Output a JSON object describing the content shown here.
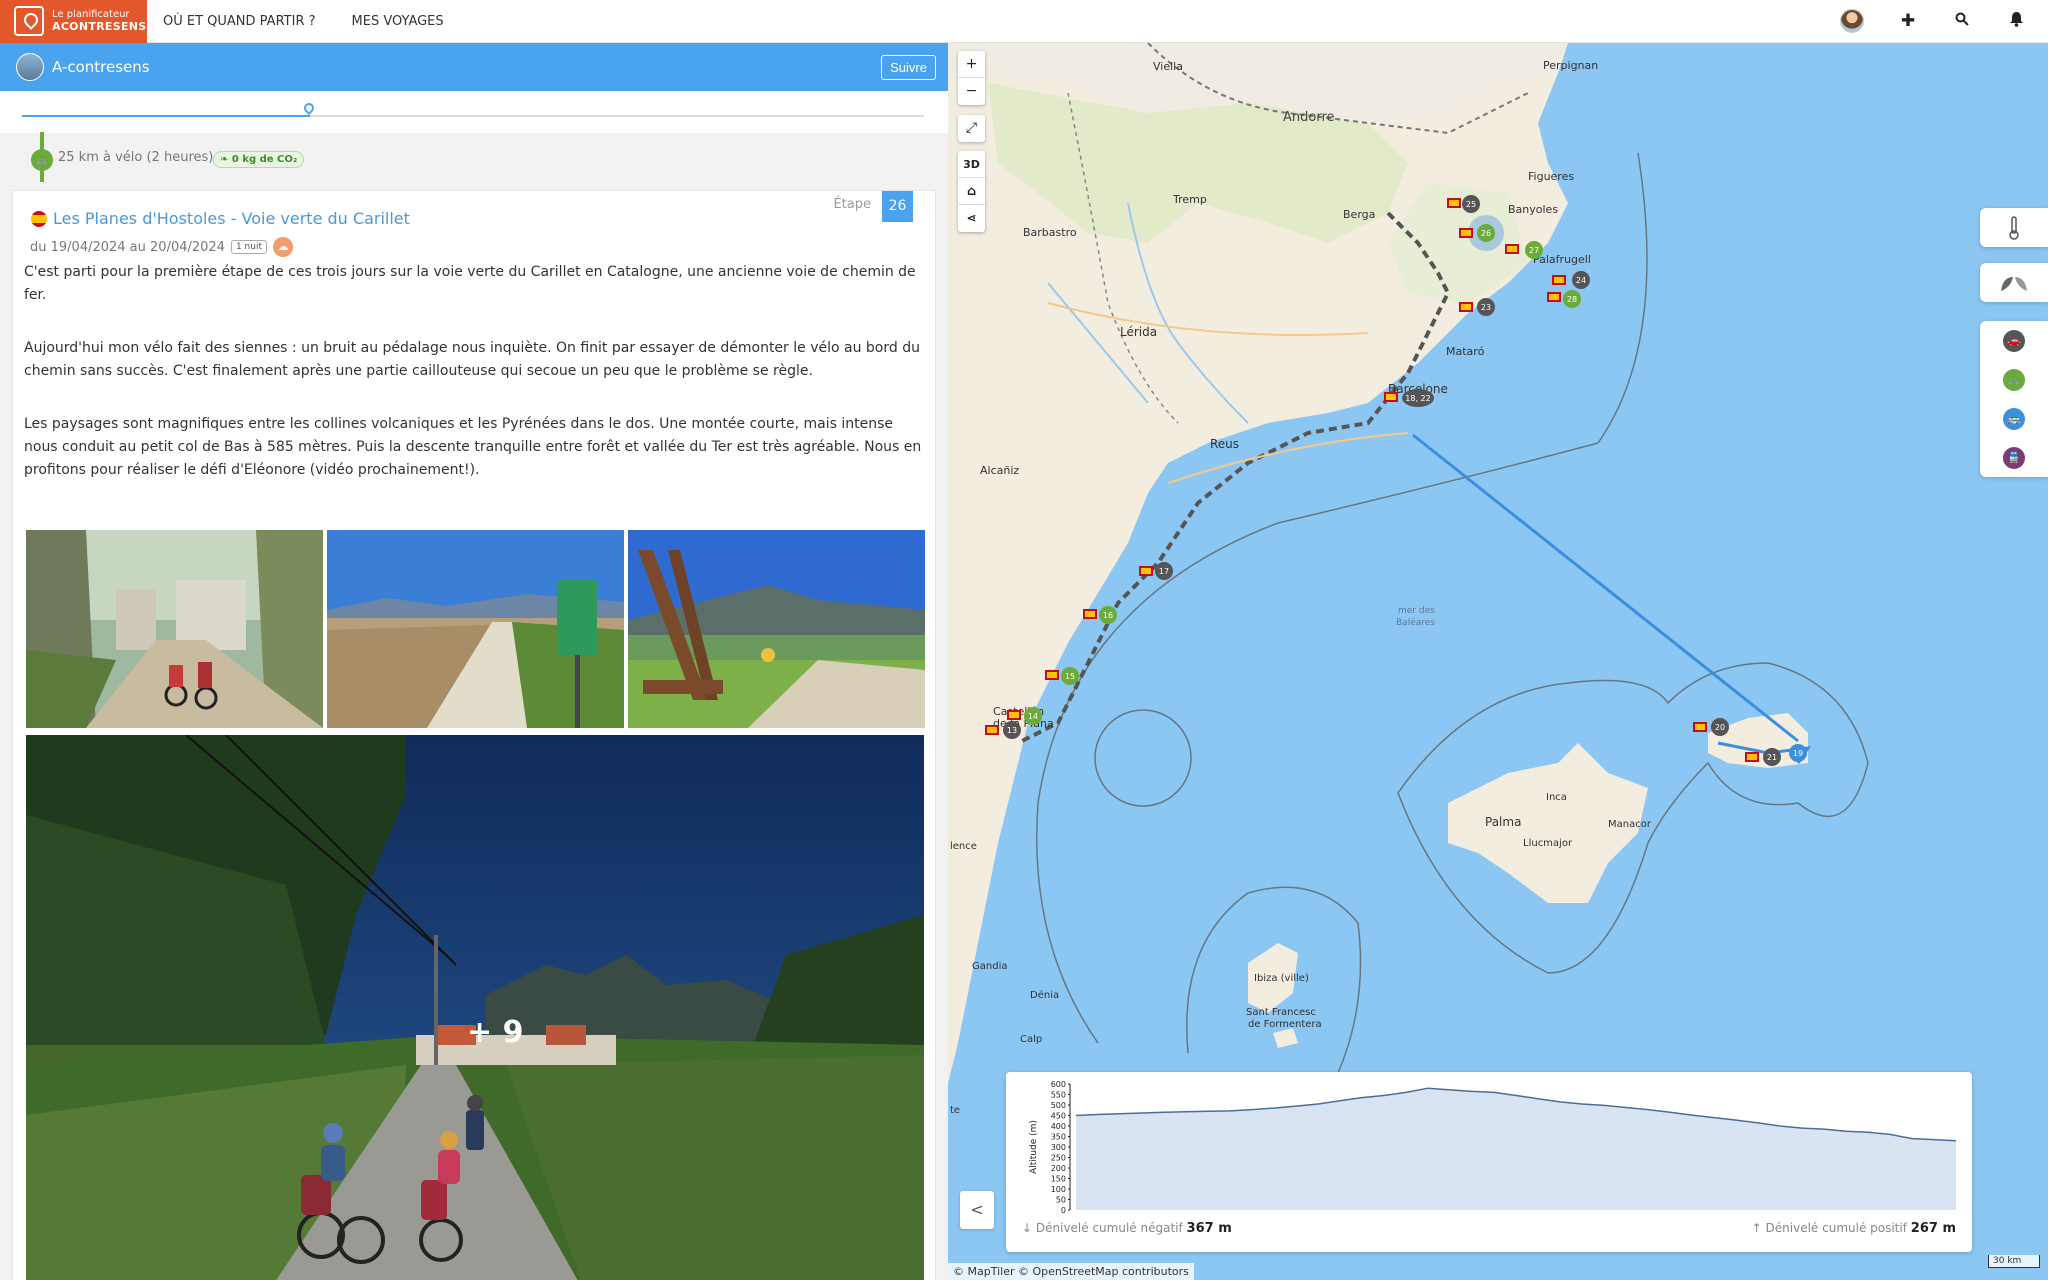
{
  "nav": {
    "logo_line1": "Le planificateur",
    "logo_line2": "ACONTRESENS",
    "links": [
      "OÙ ET QUAND PARTIR ?",
      "MES VOYAGES"
    ],
    "icons": [
      "avatar",
      "plus-icon",
      "search-icon",
      "bell-icon"
    ]
  },
  "profile": {
    "name": "A-contresens",
    "follow_label": "Suivre"
  },
  "transport": {
    "text": "25 km à vélo (2 heures)",
    "co2": "0 kg de CO₂"
  },
  "stage": {
    "title": "Les Planes d'Hostoles - Voie verte du Carillet",
    "dates": "du 19/04/2024 au 20/04/2024",
    "nights": "1 nuit",
    "etape_label": "Étape",
    "etape_number": "26",
    "paragraphs": [
      "C'est parti pour la première étape de ces trois jours sur la voie verte du Carillet en Catalogne, une ancienne voie de chemin de fer.",
      "Aujourd'hui mon vélo fait des siennes : un bruit au pédalage nous inquiète. On finit par essayer de démonter le vélo au bord du chemin sans succès. C'est finalement après une partie caillouteuse qui secoue un peu que le problème se règle.",
      "Les paysages sont magnifiques entre les collines volcaniques et les Pyrénées dans le dos. Une montée courte, mais intense nous conduit au petit col de Bas à 585 mètres. Puis la descente tranquille entre forêt et vallée du Ter est très agréable. Nous en profitons pour réaliser le défi d'Eléonore (vidéo prochainement!)."
    ],
    "more_photos": "+ 9"
  },
  "map": {
    "controls": [
      "+",
      "−",
      "⤢",
      "3D",
      "⌂",
      "<"
    ],
    "places": [
      "Viella",
      "Perpignan",
      "Andorre",
      "Tremp",
      "Berga",
      "Figueres",
      "Barbastro",
      "Banyoles",
      "Palafrugell",
      "Lérida",
      "Mataró",
      "Barcelone",
      "Reus",
      "Alcañiz",
      "Castellón de la Plana",
      "mer des Baléares",
      "Inca",
      "Manacor",
      "Palma",
      "Llucmajor",
      "Gandia",
      "Dénia",
      "Ibiza (ville)",
      "Sant Francesc de Formentera",
      "Calp",
      "lence",
      "te"
    ],
    "markers": [
      "25",
      "26",
      "27",
      "24",
      "28",
      "23",
      "18, 22",
      "17",
      "16",
      "15",
      "14",
      "13",
      "20",
      "21",
      "19"
    ],
    "attribution": "© MapTiler © OpenStreetMap contributors",
    "scale": "30 km",
    "right_icons": [
      "thermometer-icon",
      "leaf-icon",
      "car-icon",
      "bike-icon",
      "bus-icon",
      "train-icon"
    ]
  },
  "elevation": {
    "ylabel": "Altitude (m)",
    "neg_label": "Dénivelé cumulé négatif",
    "neg_value": "367 m",
    "pos_label": "Dénivelé cumulé positif",
    "pos_value": "267 m"
  },
  "chart_data": {
    "type": "area",
    "ylabel": "Altitude (m)",
    "ylim": [
      0,
      600
    ],
    "yticks": [
      0,
      50,
      100,
      150,
      200,
      250,
      300,
      350,
      400,
      450,
      500,
      550,
      600
    ],
    "values": [
      450,
      455,
      458,
      462,
      465,
      468,
      470,
      472,
      478,
      485,
      495,
      505,
      520,
      535,
      545,
      560,
      580,
      572,
      565,
      560,
      545,
      530,
      515,
      505,
      498,
      488,
      478,
      465,
      452,
      440,
      428,
      415,
      400,
      390,
      385,
      375,
      370,
      360,
      340,
      335,
      330
    ]
  },
  "colors": {
    "brand": "#e2572c",
    "accent": "#4aa3ee",
    "green": "#6aab3a",
    "sea": "#8cc6f2",
    "land": "#f3ede0"
  }
}
